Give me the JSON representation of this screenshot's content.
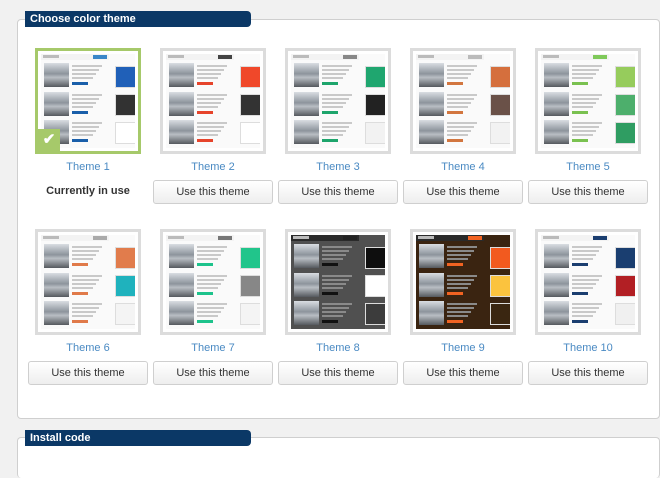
{
  "sections": {
    "theme_title": "Choose color theme",
    "install_title": "Install code"
  },
  "themes": [
    {
      "name": "Theme 1",
      "status": "Currently in use",
      "selected": true,
      "dark": false,
      "bar_btn": "#3a86c8",
      "accent": "#1a5faa",
      "swatches": [
        "#2060b8",
        "#323232",
        "#ffffff"
      ],
      "check": "✔"
    },
    {
      "name": "Theme 2",
      "action": "Use this theme",
      "dark": false,
      "bar_btn": "#444444",
      "accent": "#e6442b",
      "swatches": [
        "#f0482a",
        "#333333",
        "#ffffff"
      ]
    },
    {
      "name": "Theme 3",
      "action": "Use this theme",
      "dark": false,
      "bar_btn": "#888888",
      "accent": "#1ea56c",
      "swatches": [
        "#1fa66f",
        "#222222",
        "#f2f2f2"
      ]
    },
    {
      "name": "Theme 4",
      "action": "Use this theme",
      "dark": false,
      "bar_btn": "#bbbbbb",
      "accent": "#d2763f",
      "swatches": [
        "#d56f3d",
        "#6a5148",
        "#f2f2f2"
      ]
    },
    {
      "name": "Theme 5",
      "action": "Use this theme",
      "dark": false,
      "bar_btn": "#7fc95a",
      "accent": "#7ac150",
      "swatches": [
        "#96cc5c",
        "#4daf6c",
        "#2f9d62"
      ]
    },
    {
      "name": "Theme 6",
      "action": "Use this theme",
      "dark": false,
      "bar_btn": "#aaaaaa",
      "accent": "#e07a4a",
      "swatches": [
        "#e17c4c",
        "#1fb2bd",
        "#f4f4f4"
      ]
    },
    {
      "name": "Theme 7",
      "action": "Use this theme",
      "dark": false,
      "bar_btn": "#777777",
      "accent": "#1ec38c",
      "swatches": [
        "#21c58b",
        "#878787",
        "#f4f4f4"
      ]
    },
    {
      "name": "Theme 8",
      "action": "Use this theme",
      "dark": true,
      "bar_btn": "#222222",
      "accent": "#111111",
      "bg": "#505050",
      "swatches": [
        "#0e0e0e",
        "#ffffff",
        "#3c3c3c"
      ]
    },
    {
      "name": "Theme 9",
      "action": "Use this theme",
      "dark": true,
      "bar_btn": "#f26322",
      "accent": "#f26322",
      "bg": "#3a2411",
      "swatches": [
        "#f25a1f",
        "#fbc33e",
        "#3a2611"
      ]
    },
    {
      "name": "Theme 10",
      "action": "Use this theme",
      "dark": false,
      "bar_btn": "#1b3e70",
      "accent": "#1b3e70",
      "swatches": [
        "#1a3e70",
        "#b21f24",
        "#f0f0f0"
      ]
    }
  ]
}
